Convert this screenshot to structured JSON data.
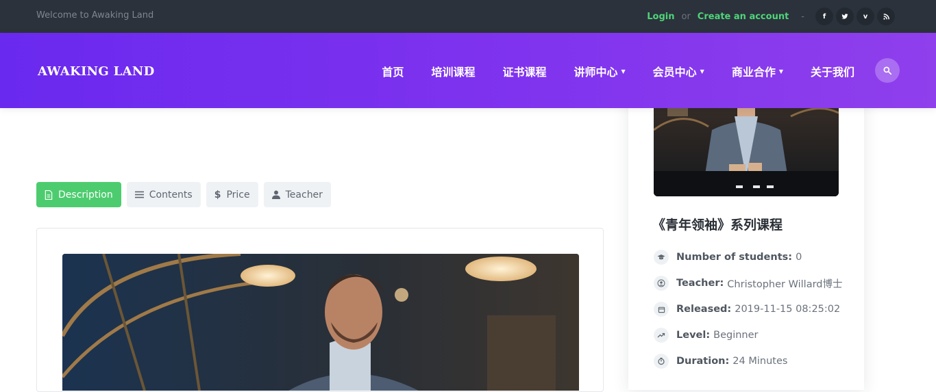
{
  "topbar": {
    "welcome": "Welcome to Awaking Land",
    "login": "Login",
    "or": "or",
    "create": "Create an account",
    "separator": "-",
    "social": [
      {
        "name": "facebook-icon",
        "glyph": "f"
      },
      {
        "name": "twitter-icon",
        "glyph": "t"
      },
      {
        "name": "vimeo-icon",
        "glyph": "v"
      },
      {
        "name": "rss-icon",
        "glyph": "r"
      }
    ]
  },
  "nav": {
    "brand": "AWAKING LAND",
    "items": [
      {
        "label": "首页",
        "dropdown": false
      },
      {
        "label": "培训课程",
        "dropdown": false
      },
      {
        "label": "证书课程",
        "dropdown": false
      },
      {
        "label": "讲师中心",
        "dropdown": true
      },
      {
        "label": "会员中心",
        "dropdown": true
      },
      {
        "label": "商业合作",
        "dropdown": true
      },
      {
        "label": "关于我们",
        "dropdown": false
      }
    ],
    "search_icon": "search-icon"
  },
  "tabs": [
    {
      "label": "Description",
      "icon": "document-icon",
      "active": true
    },
    {
      "label": "Contents",
      "icon": "list-icon",
      "active": false
    },
    {
      "label": "Price",
      "icon": "dollar-icon",
      "active": false
    },
    {
      "label": "Teacher",
      "icon": "user-icon",
      "active": false
    }
  ],
  "sidebar": {
    "title": "《青年领袖》系列课程",
    "meta": {
      "students_label": "Number of students:",
      "students_value": "0",
      "teacher_label": "Teacher:",
      "teacher_value": "Christopher Willard博士",
      "released_label": "Released:",
      "released_value": "2019-11-15 08:25:02",
      "level_label": "Level:",
      "level_value": "Beginner",
      "duration_label": "Duration:",
      "duration_value": "24 Minutes"
    }
  },
  "colors": {
    "topbar_bg": "#2b323b",
    "nav_start": "#6a29ef",
    "nav_end": "#8f3fec",
    "accent_green": "#4dcc6f",
    "link_green": "#4ed47a"
  }
}
